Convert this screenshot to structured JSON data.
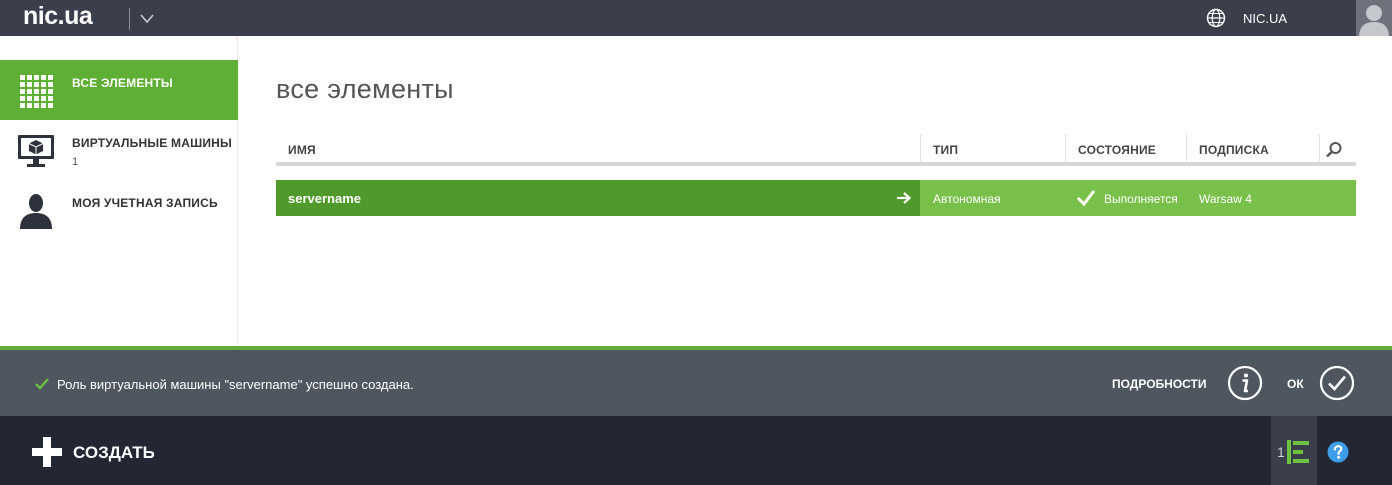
{
  "header": {
    "logo": "nic.ua",
    "account": "NIC.UA"
  },
  "sidebar": {
    "items": [
      {
        "label": "ВСЕ ЭЛЕМЕНТЫ",
        "sub": "",
        "icon": "grid-icon",
        "active": true
      },
      {
        "label": "ВИРТУАЛЬНЫЕ МАШИНЫ",
        "sub": "1",
        "icon": "monitor-icon",
        "active": false
      },
      {
        "label": "МОЯ УЧЕТНАЯ ЗАПИСЬ",
        "sub": "",
        "icon": "user-icon",
        "active": false
      }
    ]
  },
  "main": {
    "title": "все элементы",
    "columns": [
      "ИМЯ",
      "ТИП",
      "СОСТОЯНИЕ",
      "ПОДПИСКА"
    ],
    "rows": [
      {
        "name": "servername",
        "type": "Автономная",
        "status": "Выполняется",
        "subscription": "Warsaw 4"
      }
    ]
  },
  "notification": {
    "message": "Роль виртуальной машины \"servername\" успешно создана.",
    "details_label": "ПОДРОБНОСТИ",
    "ok_label": "ОК"
  },
  "footer": {
    "create_label": "СОЗДАТЬ",
    "queue_count": "1"
  },
  "colors": {
    "accent": "#5fae35",
    "row_dark": "#4f9a2a",
    "row_light": "#78c04a",
    "topbar": "#3a3f4b",
    "notification": "#4f5660",
    "footer": "#222733",
    "help": "#3e9de8"
  }
}
